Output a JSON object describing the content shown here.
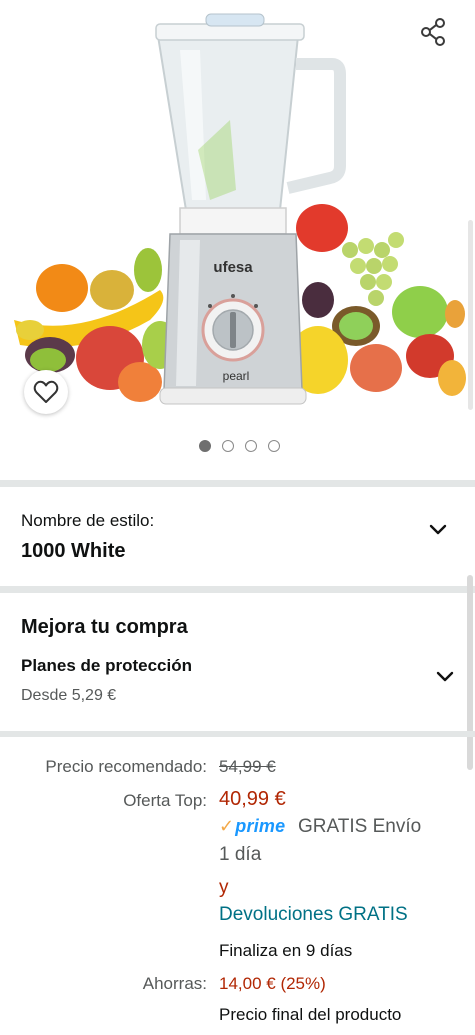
{
  "gallery": {
    "product_image": "blender-with-fruits-image",
    "brand_on_product": "ufesa",
    "model_on_product": "pearl",
    "dots_count": 4,
    "active_dot": 0
  },
  "style": {
    "label": "Nombre de estilo:",
    "value": "1000 White"
  },
  "upgrade": {
    "title": "Mejora tu compra",
    "plans_label": "Planes de protección",
    "plans_from": "Desde 5,29 €"
  },
  "pricing": {
    "list_label": "Precio recomendado:",
    "list_price": "54,99 €",
    "deal_label": "Oferta Top:",
    "deal_price": "40,99 €",
    "prime_label": "prime",
    "shipping_line1": "GRATIS Envío",
    "shipping_line2": "1 día",
    "and": "y",
    "returns": "Devoluciones GRATIS",
    "ends": "Finaliza en 9 días",
    "savings_label": "Ahorras:",
    "savings_value": "14,00 € (25%)",
    "final_note": "Precio final del producto"
  },
  "icons": {
    "share": "share-icon",
    "wishlist": "heart-icon",
    "expand": "chevron-down-icon"
  },
  "colors": {
    "deal_red": "#b12704",
    "link_teal": "#007185",
    "prime_blue": "#1a98ff",
    "separator": "#e3e6e6"
  }
}
